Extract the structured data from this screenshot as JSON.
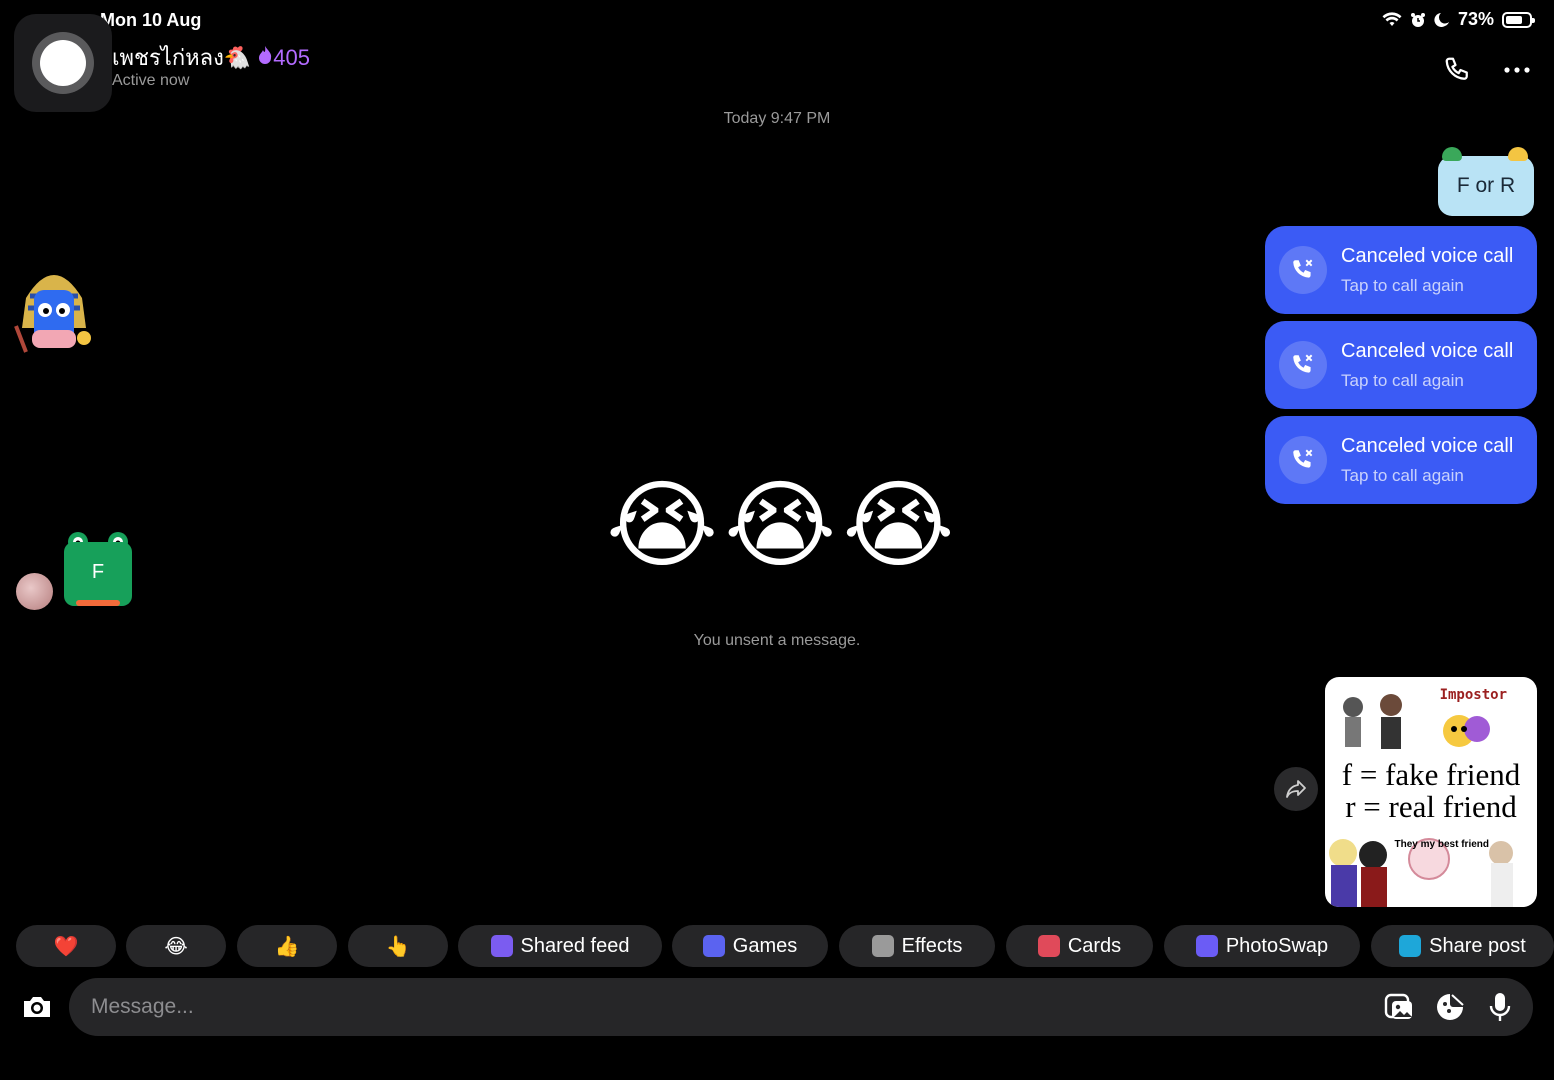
{
  "status_bar": {
    "time": "Mon 10 Aug",
    "battery": "73%",
    "battery_level": 0.73
  },
  "header": {
    "contact_name": "เพชรไก่หลง🐔",
    "streak_count": "405",
    "active_status": "Active now",
    "icons": [
      "phone-icon",
      "more-icon"
    ]
  },
  "thread": {
    "timestamp": "Today 9:47 PM",
    "sent_text": "F or R",
    "calls": [
      {
        "title": "Canceled voice call",
        "subtitle": "Tap to call again"
      },
      {
        "title": "Canceled voice call",
        "subtitle": "Tap to call again"
      },
      {
        "title": "Canceled voice call",
        "subtitle": "Tap to call again"
      }
    ],
    "frog_letter": "F",
    "emoji_message": "😭😭😭",
    "unsent_notice": "You unsent a message.",
    "meme": {
      "label": "Impostor",
      "line1": "f = fake friend",
      "line2": "r = real friend",
      "note": "They my best friend"
    }
  },
  "quick_actions": [
    {
      "label": "",
      "emoji": "❤️"
    },
    {
      "label": "",
      "emoji": "😂"
    },
    {
      "label": "",
      "emoji": "👍"
    },
    {
      "label": "",
      "emoji": "👆"
    },
    {
      "label": "Shared feed",
      "icon_color": "#7b5cf0"
    },
    {
      "label": "Games",
      "icon_color": "#5b63f0"
    },
    {
      "label": "Effects",
      "icon_color": "#9a9a9a"
    },
    {
      "label": "Cards",
      "icon_color": "#e04a5a"
    },
    {
      "label": "PhotoSwap",
      "icon_color": "#6b5cf5"
    },
    {
      "label": "Share post",
      "icon_color": "#1ea7d9"
    }
  ],
  "composer": {
    "placeholder": "Message..."
  },
  "colors": {
    "call_bubble": "#3b5bf5",
    "streak": "#b36bff",
    "sent_bubble": "#b9e3f5"
  }
}
